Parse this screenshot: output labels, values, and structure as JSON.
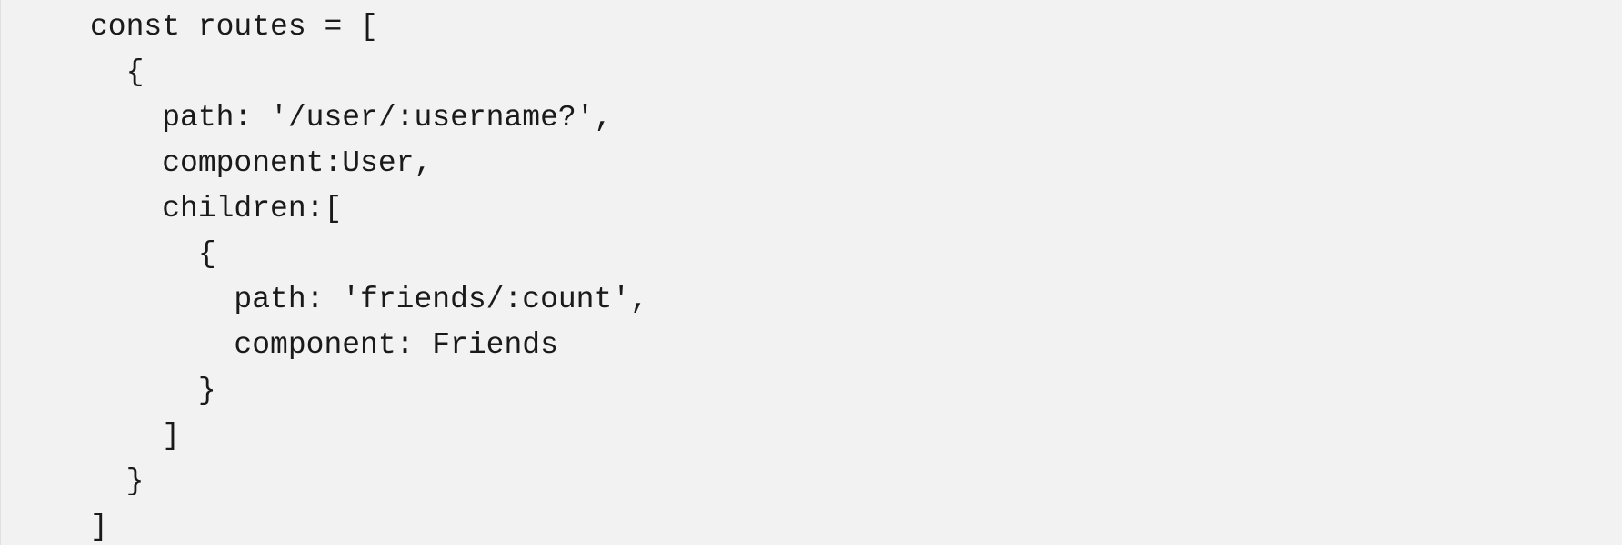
{
  "code": {
    "lines": [
      "const routes = [",
      "  {",
      "    path: '/user/:username?',",
      "    component:User,",
      "    children:[",
      "      {",
      "        path: 'friends/:count',",
      "        component: Friends",
      "      }",
      "    ]",
      "  }",
      "]"
    ]
  }
}
